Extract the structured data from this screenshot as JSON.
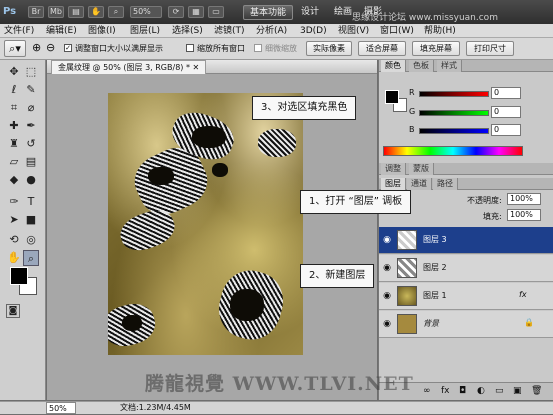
{
  "app": {
    "logo": "Ps",
    "zoom": "50%"
  },
  "workspaces": {
    "basic": "基本功能",
    "design": "设计",
    "paint": "绘画",
    "photo": "摄影"
  },
  "top_watermark": "思缘设计论坛 www.missyuan.com",
  "menu": [
    "文件(F)",
    "编辑(E)",
    "图像(I)",
    "图层(L)",
    "选择(S)",
    "滤镜(T)",
    "分析(A)",
    "3D(D)",
    "视图(V)",
    "窗口(W)",
    "帮助(H)"
  ],
  "options": {
    "resize_windows": "调整窗口大小以满屏显示",
    "zoom_all": "缩放所有窗口",
    "scrubby_zoom": "细微缩放",
    "actual_pixels": "实际像素",
    "fit_screen": "适合屏幕",
    "fill_screen": "填充屏幕",
    "print_size": "打印尺寸"
  },
  "document": {
    "tab_title": "金属纹理 @ 50% (图层 3, RGB/8) *",
    "zoom": "50%",
    "doc_size": "文档:1.23M/4.45M"
  },
  "color_panel": {
    "tabs": [
      "颜色",
      "色板",
      "样式"
    ],
    "R": {
      "label": "R",
      "value": "0"
    },
    "G": {
      "label": "G",
      "value": "0"
    },
    "B": {
      "label": "B",
      "value": "0"
    },
    "colors": {
      "fg": "#000000",
      "bg": "#ffffff"
    }
  },
  "adjust_tabs": [
    "调整",
    "蒙版"
  ],
  "layers_panel": {
    "tabs": [
      "图层",
      "通道",
      "路径"
    ],
    "opacity_label": "不透明度:",
    "opacity_value": "100%",
    "fill_label": "填充:",
    "fill_value": "100%",
    "layers": [
      {
        "name": "图层 3",
        "selected": true
      },
      {
        "name": "图层 2",
        "selected": false
      },
      {
        "name": "图层 1",
        "selected": false,
        "fx": "fx"
      },
      {
        "name": "背景",
        "selected": false,
        "locked": true
      }
    ]
  },
  "callouts": {
    "step1": "1、打开 “图层” 调板",
    "step2": "2、新建图层",
    "step3": "3、对选区填充黑色"
  },
  "watermark": "腾龍視覺 WWW.TLVI.NET"
}
